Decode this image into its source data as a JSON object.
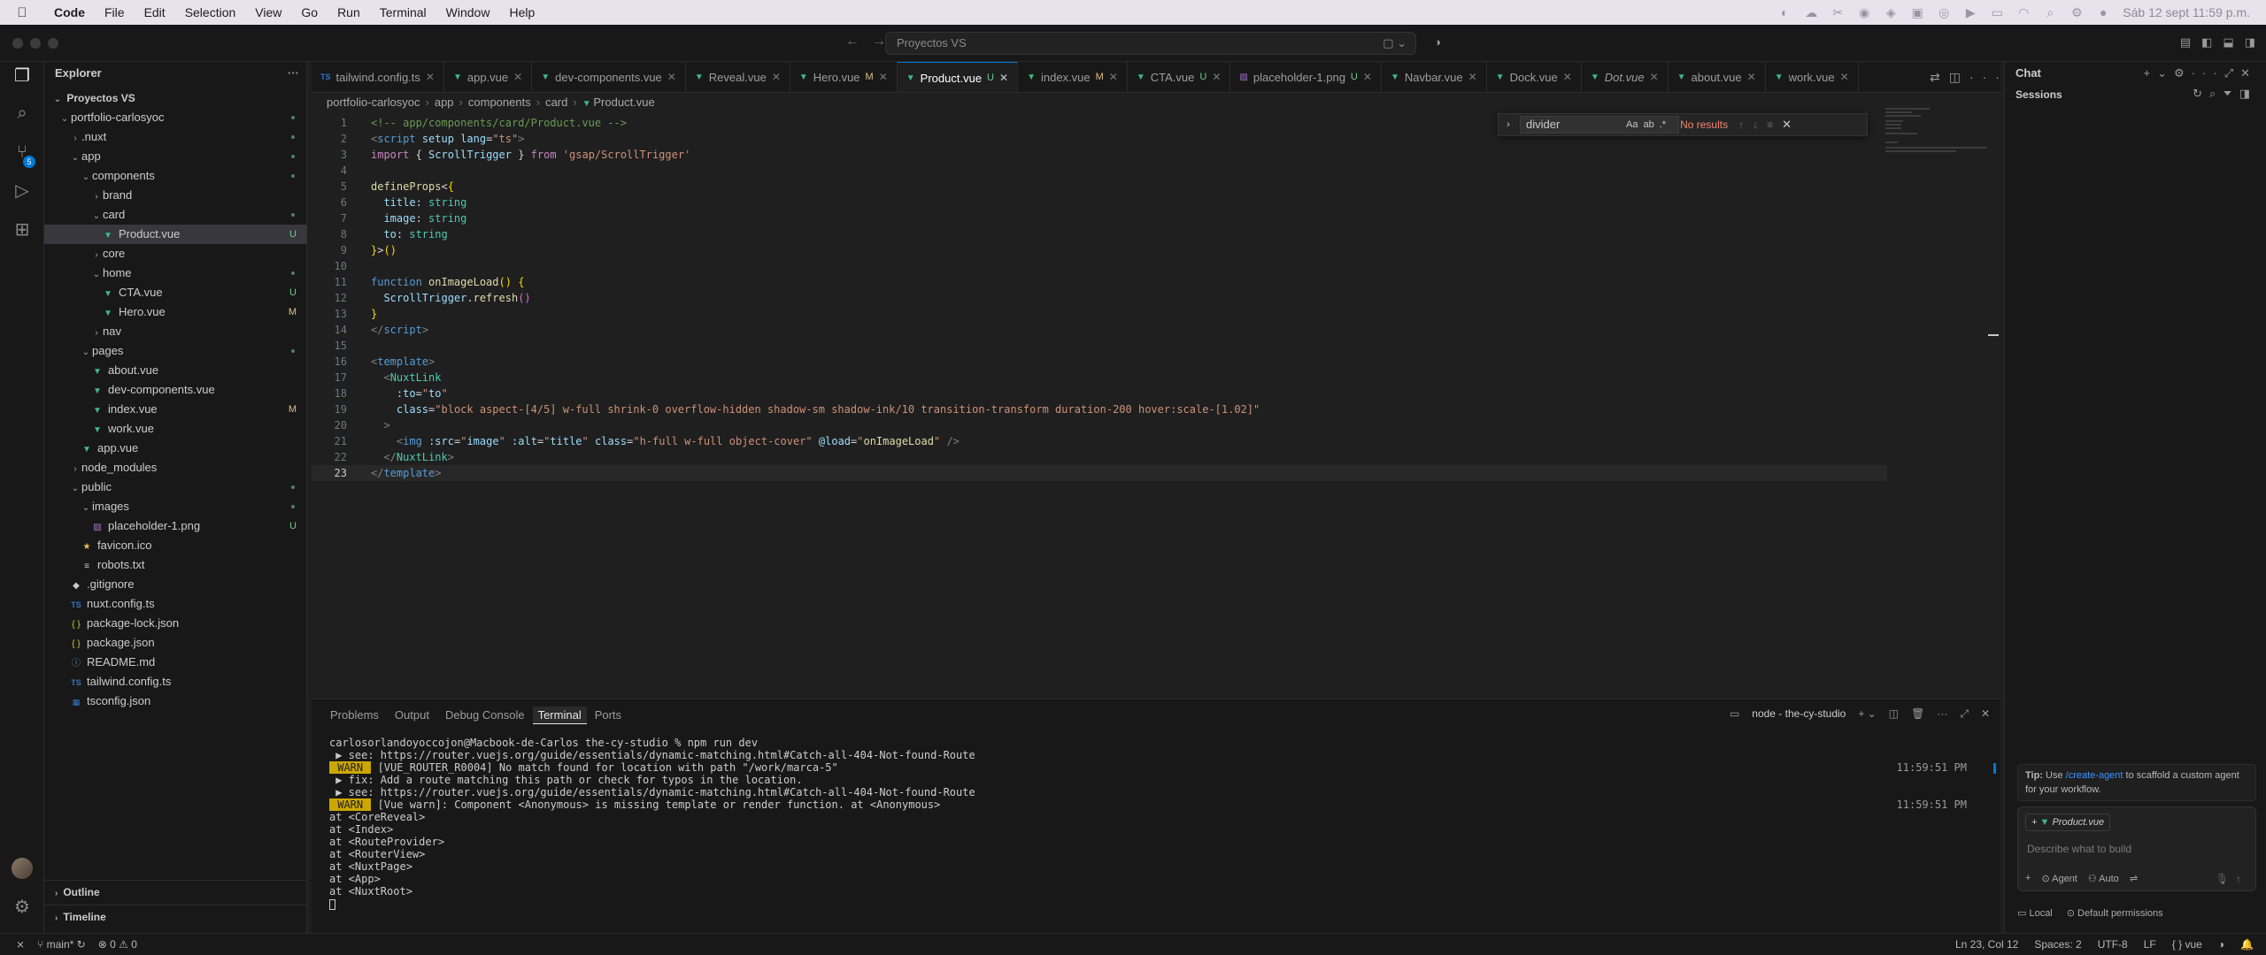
{
  "menubar": {
    "app_name": "Code",
    "items": [
      "File",
      "Edit",
      "Selection",
      "View",
      "Go",
      "Run",
      "Terminal",
      "Window",
      "Help"
    ],
    "clock": "Sáb 12 sept  11:59 p.m."
  },
  "titlebar": {
    "command_center": "Proyectos VS"
  },
  "activitybar": {
    "scm_badge": "5"
  },
  "explorer": {
    "title": "Explorer",
    "workspace": "Proyectos VS",
    "tree": [
      {
        "label": "portfolio-carlosyoc",
        "depth": 1,
        "kind": "folder",
        "open": true,
        "dot": true
      },
      {
        "label": ".nuxt",
        "depth": 2,
        "kind": "folder",
        "open": false,
        "dot": true
      },
      {
        "label": "app",
        "depth": 2,
        "kind": "folder",
        "open": true,
        "dot": true
      },
      {
        "label": "components",
        "depth": 3,
        "kind": "folder",
        "open": true,
        "dot": true
      },
      {
        "label": "brand",
        "depth": 4,
        "kind": "folder",
        "open": false
      },
      {
        "label": "card",
        "depth": 4,
        "kind": "folder",
        "open": true,
        "dot": true
      },
      {
        "label": "Product.vue",
        "depth": 5,
        "kind": "vue",
        "status": "U",
        "selected": true
      },
      {
        "label": "core",
        "depth": 4,
        "kind": "folder",
        "open": false
      },
      {
        "label": "home",
        "depth": 4,
        "kind": "folder",
        "open": true,
        "dot": true
      },
      {
        "label": "CTA.vue",
        "depth": 5,
        "kind": "vue",
        "status": "U"
      },
      {
        "label": "Hero.vue",
        "depth": 5,
        "kind": "vue",
        "status": "M"
      },
      {
        "label": "nav",
        "depth": 4,
        "kind": "folder",
        "open": false
      },
      {
        "label": "pages",
        "depth": 3,
        "kind": "folder",
        "open": true,
        "dot": true
      },
      {
        "label": "about.vue",
        "depth": 4,
        "kind": "vue"
      },
      {
        "label": "dev-components.vue",
        "depth": 4,
        "kind": "vue"
      },
      {
        "label": "index.vue",
        "depth": 4,
        "kind": "vue",
        "status": "M"
      },
      {
        "label": "work.vue",
        "depth": 4,
        "kind": "vue"
      },
      {
        "label": "app.vue",
        "depth": 3,
        "kind": "vue"
      },
      {
        "label": "node_modules",
        "depth": 2,
        "kind": "folder",
        "open": false
      },
      {
        "label": "public",
        "depth": 2,
        "kind": "folder",
        "open": true,
        "dot": true
      },
      {
        "label": "images",
        "depth": 3,
        "kind": "folder",
        "open": true,
        "dot": true
      },
      {
        "label": "placeholder-1.png",
        "depth": 4,
        "kind": "png",
        "status": "U"
      },
      {
        "label": "favicon.ico",
        "depth": 3,
        "kind": "star"
      },
      {
        "label": "robots.txt",
        "depth": 3,
        "kind": "text"
      },
      {
        "label": ".gitignore",
        "depth": 2,
        "kind": "git"
      },
      {
        "label": "nuxt.config.ts",
        "depth": 2,
        "kind": "ts"
      },
      {
        "label": "package-lock.json",
        "depth": 2,
        "kind": "json"
      },
      {
        "label": "package.json",
        "depth": 2,
        "kind": "json"
      },
      {
        "label": "README.md",
        "depth": 2,
        "kind": "info"
      },
      {
        "label": "tailwind.config.ts",
        "depth": 2,
        "kind": "ts"
      },
      {
        "label": "tsconfig.json",
        "depth": 2,
        "kind": "tsjson"
      }
    ],
    "outline_label": "Outline",
    "timeline_label": "Timeline"
  },
  "tabs": [
    {
      "label": "tailwind.config.ts",
      "kind": "ts"
    },
    {
      "label": "app.vue",
      "kind": "vue"
    },
    {
      "label": "dev-components.vue",
      "kind": "vue"
    },
    {
      "label": "Reveal.vue",
      "kind": "vue"
    },
    {
      "label": "Hero.vue",
      "kind": "vue",
      "badge": "M"
    },
    {
      "label": "Product.vue",
      "kind": "vue",
      "badge": "U",
      "active": true
    },
    {
      "label": "index.vue",
      "kind": "vue",
      "badge": "M"
    },
    {
      "label": "CTA.vue",
      "kind": "vue",
      "badge": "U"
    },
    {
      "label": "placeholder-1.png",
      "kind": "png",
      "badge": "U"
    },
    {
      "label": "Navbar.vue",
      "kind": "vue"
    },
    {
      "label": "Dock.vue",
      "kind": "vue"
    },
    {
      "label": "Dot.vue",
      "kind": "vue",
      "italic": true
    },
    {
      "label": "about.vue",
      "kind": "vue"
    },
    {
      "label": "work.vue",
      "kind": "vue"
    }
  ],
  "breadcrumb": [
    "portfolio-carlosyoc",
    "app",
    "components",
    "card",
    "Product.vue"
  ],
  "find": {
    "query": "divider",
    "result": "No results"
  },
  "code_lines": [
    [
      [
        "c-com",
        "<!-- app/components/card/Product.vue -->"
      ]
    ],
    [
      [
        "c-tag",
        "<"
      ],
      [
        "c-tn",
        "script"
      ],
      [
        "c-punc",
        " "
      ],
      [
        "c-attr",
        "setup"
      ],
      [
        "c-punc",
        " "
      ],
      [
        "c-attr",
        "lang"
      ],
      [
        "c-punc",
        "="
      ],
      [
        "c-str",
        "\"ts\""
      ],
      [
        "c-tag",
        ">"
      ]
    ],
    [
      [
        "c-kw",
        "import"
      ],
      [
        "c-punc",
        " { "
      ],
      [
        "c-var",
        "ScrollTrigger"
      ],
      [
        "c-punc",
        " } "
      ],
      [
        "c-kw",
        "from"
      ],
      [
        "c-punc",
        " "
      ],
      [
        "c-str",
        "'gsap/ScrollTrigger'"
      ]
    ],
    [],
    [
      [
        "c-fn",
        "defineProps"
      ],
      [
        "c-punc",
        "<"
      ],
      [
        "c-br1",
        "{"
      ]
    ],
    [
      [
        "c-punc",
        "  "
      ],
      [
        "c-var",
        "title"
      ],
      [
        "c-punc",
        ": "
      ],
      [
        "c-type",
        "string"
      ]
    ],
    [
      [
        "c-punc",
        "  "
      ],
      [
        "c-var",
        "image"
      ],
      [
        "c-punc",
        ": "
      ],
      [
        "c-type",
        "string"
      ]
    ],
    [
      [
        "c-punc",
        "  "
      ],
      [
        "c-var",
        "to"
      ],
      [
        "c-punc",
        ": "
      ],
      [
        "c-type",
        "string"
      ]
    ],
    [
      [
        "c-br1",
        "}"
      ],
      [
        "c-punc",
        ">"
      ],
      [
        "c-br1",
        "()"
      ]
    ],
    [],
    [
      [
        "c-kw2",
        "function"
      ],
      [
        "c-punc",
        " "
      ],
      [
        "c-fn",
        "onImageLoad"
      ],
      [
        "c-br1",
        "()"
      ],
      [
        "c-punc",
        " "
      ],
      [
        "c-br1",
        "{"
      ]
    ],
    [
      [
        "c-punc",
        "  "
      ],
      [
        "c-var",
        "ScrollTrigger"
      ],
      [
        "c-punc",
        "."
      ],
      [
        "c-fn",
        "refresh"
      ],
      [
        "c-br2",
        "()"
      ]
    ],
    [
      [
        "c-br1",
        "}"
      ]
    ],
    [
      [
        "c-tag",
        "</"
      ],
      [
        "c-tn",
        "script"
      ],
      [
        "c-tag",
        ">"
      ]
    ],
    [],
    [
      [
        "c-tag",
        "<"
      ],
      [
        "c-tn",
        "template"
      ],
      [
        "c-tag",
        ">"
      ]
    ],
    [
      [
        "c-punc",
        "  "
      ],
      [
        "c-tag",
        "<"
      ],
      [
        "c-type",
        "NuxtLink"
      ]
    ],
    [
      [
        "c-punc",
        "    "
      ],
      [
        "c-attr",
        ":to"
      ],
      [
        "c-punc",
        "="
      ],
      [
        "c-str",
        "\""
      ],
      [
        "c-var",
        "to"
      ],
      [
        "c-str",
        "\""
      ]
    ],
    [
      [
        "c-punc",
        "    "
      ],
      [
        "c-attr",
        "class"
      ],
      [
        "c-punc",
        "="
      ],
      [
        "c-str",
        "\"block aspect-[4/5] w-full shrink-0 overflow-hidden shadow-sm shadow-ink/10 transition-transform duration-200 hover:scale-[1.02]\""
      ]
    ],
    [
      [
        "c-punc",
        "  "
      ],
      [
        "c-tag",
        ">"
      ]
    ],
    [
      [
        "c-punc",
        "    "
      ],
      [
        "c-tag",
        "<"
      ],
      [
        "c-tn",
        "img"
      ],
      [
        "c-punc",
        " "
      ],
      [
        "c-attr",
        ":src"
      ],
      [
        "c-punc",
        "="
      ],
      [
        "c-str",
        "\""
      ],
      [
        "c-var",
        "image"
      ],
      [
        "c-str",
        "\""
      ],
      [
        "c-punc",
        " "
      ],
      [
        "c-attr",
        ":alt"
      ],
      [
        "c-punc",
        "="
      ],
      [
        "c-str",
        "\""
      ],
      [
        "c-var",
        "title"
      ],
      [
        "c-str",
        "\""
      ],
      [
        "c-punc",
        " "
      ],
      [
        "c-attr",
        "class"
      ],
      [
        "c-punc",
        "="
      ],
      [
        "c-str",
        "\"h-full w-full object-cover\""
      ],
      [
        "c-punc",
        " "
      ],
      [
        "c-attr",
        "@load"
      ],
      [
        "c-punc",
        "="
      ],
      [
        "c-str",
        "\""
      ],
      [
        "c-fn",
        "onImageLoad"
      ],
      [
        "c-str",
        "\""
      ],
      [
        "c-punc",
        " "
      ],
      [
        "c-tag",
        "/>"
      ]
    ],
    [
      [
        "c-punc",
        "  "
      ],
      [
        "c-tag",
        "</"
      ],
      [
        "c-type",
        "NuxtLink"
      ],
      [
        "c-tag",
        ">"
      ]
    ],
    [
      [
        "c-tag",
        "</"
      ],
      [
        "c-tn",
        "template"
      ],
      [
        "c-tag",
        ">"
      ]
    ]
  ],
  "panel": {
    "tabs": [
      "Problems",
      "Output",
      "Debug Console",
      "Terminal",
      "Ports"
    ],
    "active_tab": "Terminal",
    "terminal_name": "node - the-cy-studio"
  },
  "terminal_lines": [
    {
      "text": "carlosorlandoyoccojon@Macbook-de-Carlos the-cy-studio % npm run dev"
    },
    {
      "text": " ▶ see: https://router.vuejs.org/guide/essentials/dynamic-matching.html#Catch-all-404-Not-found-Route"
    },
    {
      "warn": " WARN ",
      "text": " [VUE_ROUTER_R0004] No match found for location with path \"/work/marca-5\"",
      "time": "11:59:51 PM"
    },
    {
      "text": " ▶ fix: Add a route matching this path or check for typos in the location."
    },
    {
      "text": " ▶ see: https://router.vuejs.org/guide/essentials/dynamic-matching.html#Catch-all-404-Not-found-Route"
    },
    {
      "warn": " WARN ",
      "text": " [Vue warn]: Component <Anonymous> is missing template or render function. at <Anonymous>",
      "time": "11:59:51 PM"
    },
    {
      "text": "at <CoreReveal>"
    },
    {
      "text": "at <Index>"
    },
    {
      "text": "at <RouteProvider>"
    },
    {
      "text": "at <RouterView>"
    },
    {
      "text": "at <NuxtPage>"
    },
    {
      "text": "at <App>"
    },
    {
      "text": "at <NuxtRoot>"
    }
  ],
  "chat": {
    "title": "Chat",
    "sessions_label": "Sessions",
    "tip_prefix": "Tip: Use ",
    "tip_link": "/create-agent",
    "tip_suffix": " to scaffold a custom agent for your workflow.",
    "context_chip": "Product.vue",
    "input_placeholder": "Describe what to build",
    "mode": "Agent",
    "model": "Auto",
    "footer_local": "Local",
    "footer_permissions": "Default permissions"
  },
  "statusbar": {
    "branch": "main*",
    "errors": "0",
    "warnings": "0",
    "position": "Ln 23, Col 12",
    "spaces": "Spaces: 2",
    "encoding": "UTF-8",
    "eol": "LF",
    "language": "vue"
  }
}
